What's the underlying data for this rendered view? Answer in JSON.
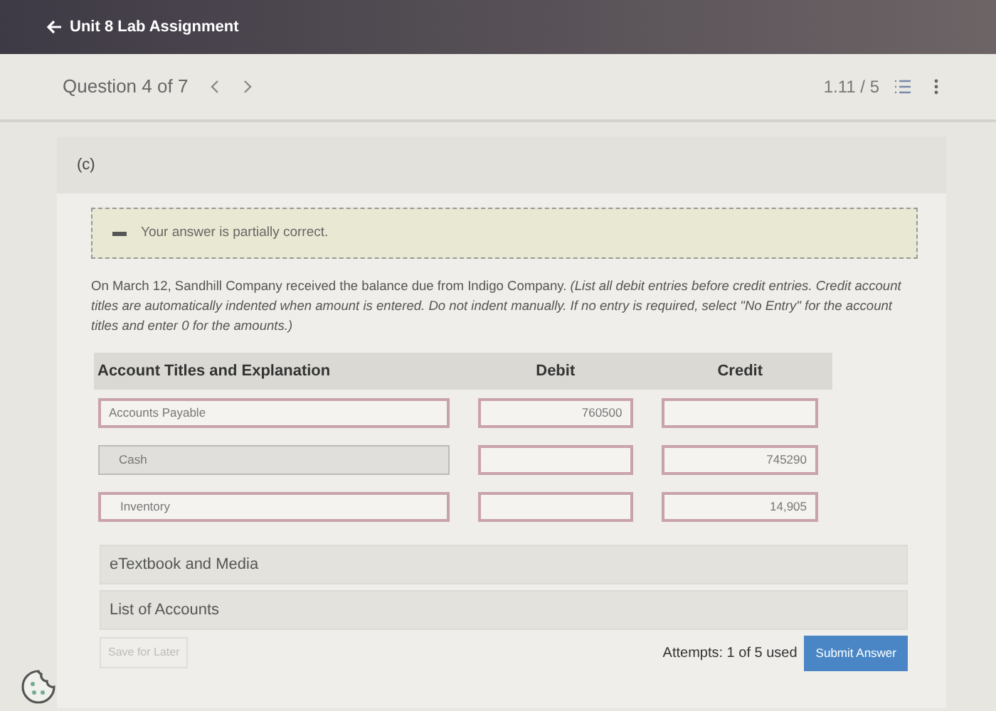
{
  "header": {
    "title": "Unit 8 Lab Assignment"
  },
  "question_bar": {
    "label": "Question 4 of 7",
    "score": "1.11 / 5"
  },
  "part": {
    "label": "(c)"
  },
  "feedback": {
    "text": "Your answer is partially correct."
  },
  "instructions": "On March 12, Sandhill Company received the balance due from Indigo Company. *(List all debit entries before credit entries. Credit account titles are automatically indented when amount is entered. Do not indent manually. If no entry is required, select \"No Entry\" for the account titles and enter 0 for the amounts.)*",
  "table": {
    "columns": [
      "Account Titles and Explanation",
      "Debit",
      "Credit"
    ],
    "rows": [
      {
        "account": {
          "value": "Accounts Payable",
          "incorrect": true
        },
        "debit": {
          "value": "760500",
          "incorrect": true
        },
        "credit": {
          "incorrect": true
        }
      },
      {
        "account": {
          "value": "Cash",
          "incorrect": false
        },
        "debit": {
          "incorrect": true
        },
        "credit": {
          "value": "745290",
          "incorrect": true
        }
      },
      {
        "account": {
          "value": "Inventory",
          "incorrect": true
        },
        "debit": {
          "incorrect": true
        },
        "credit": {
          "value": "14,905",
          "incorrect": true
        }
      }
    ]
  },
  "resources": [
    "eTextbook and Media",
    "List of Accounts"
  ],
  "footer": {
    "save_button": {
      "label": "Save for Later",
      "disabled": true
    },
    "attempts": "Attempts: 1 of 5 used",
    "submit_button": {
      "label": "Submit Answer",
      "disabled": false
    }
  }
}
